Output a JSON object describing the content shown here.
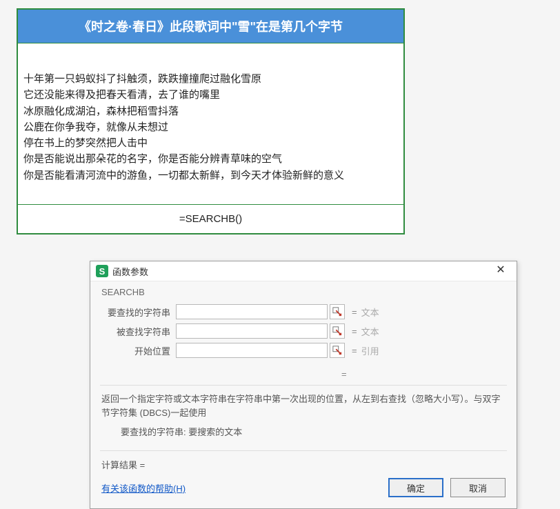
{
  "sheet": {
    "header": "《时之卷·春日》此段歌词中\"雪\"在是第几个字节",
    "lyrics": [
      "十年第一只蚂蚁抖了抖触须，跌跌撞撞爬过融化雪原",
      "它还没能来得及把春天看清，去了谁的嘴里",
      "冰原融化成湖泊，森林把稻雪抖落",
      "公鹿在你争我夺，就像从未想过",
      "停在书上的梦突然把人击中",
      "你是否能说出那朵花的名字，你是否能分辨青草味的空气",
      "你是否能看清河流中的游鱼，一切都太新鲜，到今天才体验新鲜的意义"
    ],
    "formula": "=SEARCHB()"
  },
  "dialog": {
    "appicon_letter": "S",
    "title": "函数参数",
    "func_name": "SEARCHB",
    "fields": [
      {
        "label": "要查找的字符串",
        "value": "",
        "type_hint": "文本"
      },
      {
        "label": "被查找字符串",
        "value": "",
        "type_hint": "文本"
      },
      {
        "label": "开始位置",
        "value": "",
        "type_hint": "引用"
      }
    ],
    "preview": "=",
    "description": "返回一个指定字符或文本字符串在字符串中第一次出现的位置，从左到右查找（忽略大小写）。与双字节字符集 (DBCS)一起使用",
    "param_hint_label": "要查找的字符串:",
    "param_hint_text": "要搜索的文本",
    "result_label": "计算结果 =",
    "help_link": "有关该函数的帮助(H)",
    "ok": "确定",
    "cancel": "取消"
  }
}
